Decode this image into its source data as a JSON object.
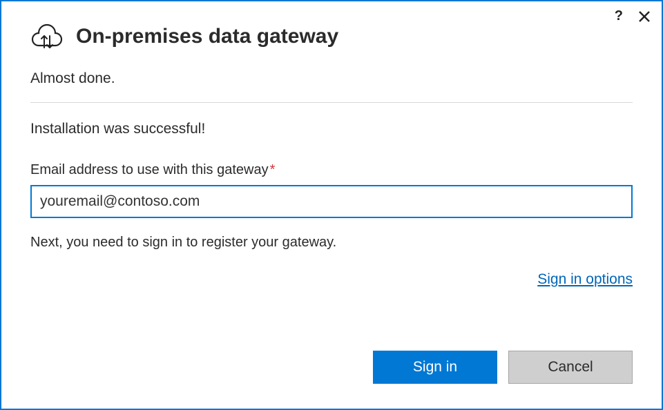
{
  "header": {
    "title": "On-premises data gateway"
  },
  "subtitle": "Almost done.",
  "status": "Installation was successful!",
  "emailField": {
    "label": "Email address to use with this gateway",
    "requiredMark": "*",
    "value": "youremail@contoso.com"
  },
  "nextStep": "Next, you need to sign in to register your gateway.",
  "links": {
    "signInOptions": "Sign in options"
  },
  "buttons": {
    "signIn": "Sign in",
    "cancel": "Cancel"
  },
  "icons": {
    "help": "?",
    "close": "✕"
  }
}
